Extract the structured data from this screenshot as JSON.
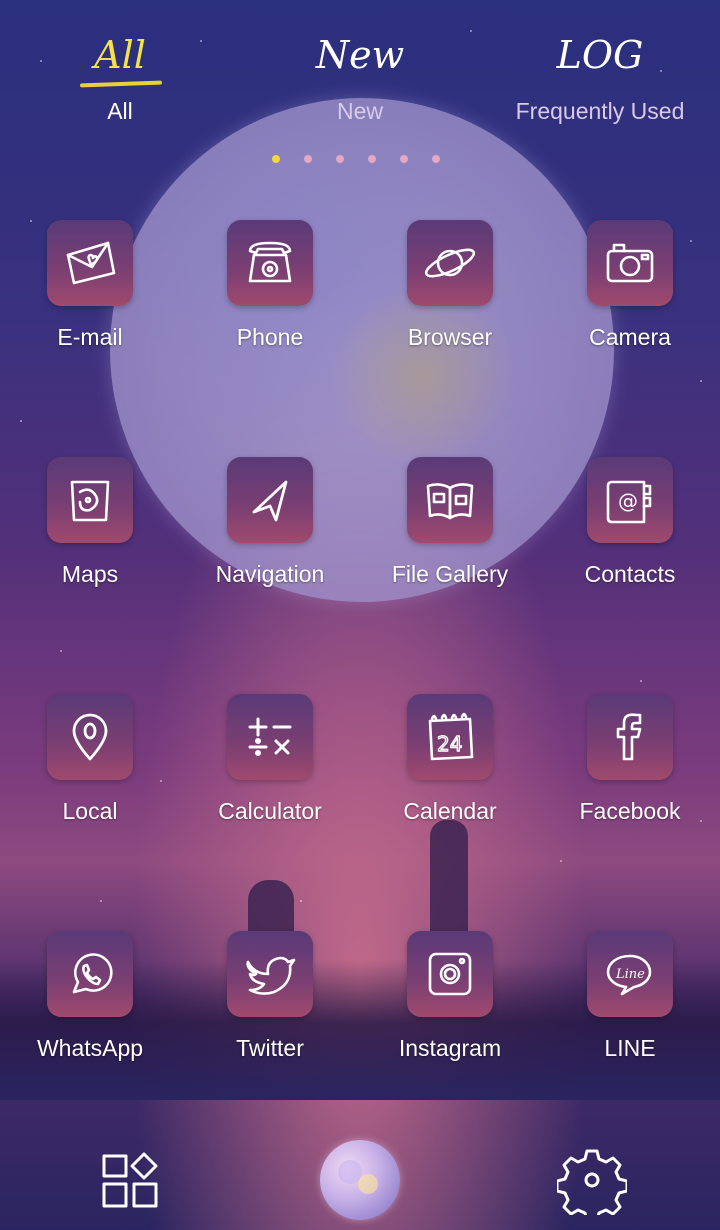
{
  "tabs": [
    {
      "script": "All",
      "label": "All"
    },
    {
      "script": "New",
      "label": "New"
    },
    {
      "script": "LOG",
      "label": "Frequently Used"
    }
  ],
  "page_indicator": {
    "count": 6,
    "active": 0
  },
  "apps": [
    {
      "label": "E-mail",
      "icon": "envelope-icon"
    },
    {
      "label": "Phone",
      "icon": "phone-icon"
    },
    {
      "label": "Browser",
      "icon": "planet-icon"
    },
    {
      "label": "Camera",
      "icon": "camera-icon"
    },
    {
      "label": "Maps",
      "icon": "map-icon"
    },
    {
      "label": "Navigation",
      "icon": "navigation-arrow-icon"
    },
    {
      "label": "File Gallery",
      "icon": "book-icon"
    },
    {
      "label": "Contacts",
      "icon": "address-book-icon"
    },
    {
      "label": "Local",
      "icon": "location-pin-icon"
    },
    {
      "label": "Calculator",
      "icon": "calculator-icon"
    },
    {
      "label": "Calendar",
      "icon": "calendar-icon",
      "day": "24"
    },
    {
      "label": "Facebook",
      "icon": "facebook-icon",
      "glyph": "f"
    },
    {
      "label": "WhatsApp",
      "icon": "whatsapp-icon"
    },
    {
      "label": "Twitter",
      "icon": "bird-icon"
    },
    {
      "label": "Instagram",
      "icon": "instagram-icon"
    },
    {
      "label": "LINE",
      "icon": "line-icon",
      "glyph": "Line"
    }
  ],
  "dock": [
    {
      "icon": "widgets-icon"
    },
    {
      "icon": "moon-theme-icon"
    },
    {
      "icon": "settings-gear-icon"
    }
  ],
  "colors": {
    "accent": "#f4e24a",
    "tile_top": "#5a3a78",
    "tile_bottom": "#a04a6e"
  }
}
